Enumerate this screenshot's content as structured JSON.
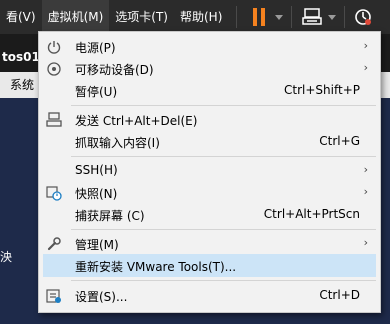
{
  "menubar": {
    "items": [
      {
        "label": "看(V)"
      },
      {
        "label": "虚拟机(M)"
      },
      {
        "label": "选项卡(T)"
      },
      {
        "label": "帮助(H)"
      }
    ]
  },
  "background": {
    "tab_title": "tos01",
    "subbar_item": "系统",
    "side_text": "泱"
  },
  "menu": {
    "items": [
      {
        "label": "电源(P)",
        "shortcut": "",
        "submenu": true,
        "icon": "power-icon"
      },
      {
        "label": "可移动设备(D)",
        "shortcut": "",
        "submenu": true,
        "icon": "removable-device-icon"
      },
      {
        "label": "暂停(U)",
        "shortcut": "Ctrl+Shift+P",
        "submenu": false,
        "icon": ""
      },
      {
        "label": "发送 Ctrl+Alt+Del(E)",
        "shortcut": "",
        "submenu": false,
        "icon": "send-keys-icon"
      },
      {
        "label": "抓取输入内容(I)",
        "shortcut": "Ctrl+G",
        "submenu": false,
        "icon": ""
      },
      {
        "label": "SSH(H)",
        "shortcut": "",
        "submenu": true,
        "icon": ""
      },
      {
        "label": "快照(N)",
        "shortcut": "",
        "submenu": true,
        "icon": "snapshot-icon"
      },
      {
        "label": "捕获屏幕 (C)",
        "shortcut": "Ctrl+Alt+PrtScn",
        "submenu": false,
        "icon": ""
      },
      {
        "label": "管理(M)",
        "shortcut": "",
        "submenu": true,
        "icon": "wrench-icon"
      },
      {
        "label": "重新安装 VMware Tools(T)...",
        "shortcut": "",
        "submenu": false,
        "icon": ""
      },
      {
        "label": "设置(S)...",
        "shortcut": "Ctrl+D",
        "submenu": false,
        "icon": "settings-icon"
      }
    ],
    "arrow": "›"
  },
  "colors": {
    "menubar_bg": "#2b2b2b",
    "menu_bg": "#f2f2f2",
    "highlight": "#cce4f7",
    "pause_accent": "#f5821f"
  }
}
